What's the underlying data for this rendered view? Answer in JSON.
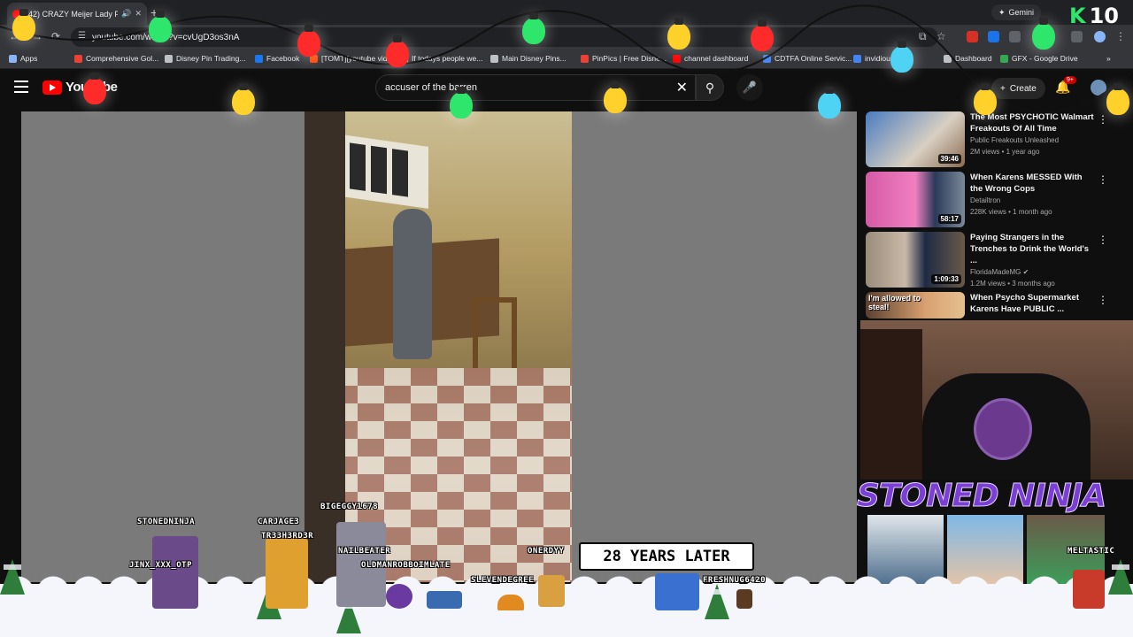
{
  "browser": {
    "tab_title": "(42) CRAZY Meijer Lady Fre",
    "new_tab": "+",
    "gemini_label": "Gemini",
    "url": "youtube.com/watch?v=cvUgD3os3nA"
  },
  "bookmarks": [
    {
      "label": "Apps",
      "color": "#8ab4f8"
    },
    {
      "label": "Comprehensive Gol...",
      "color": "#ea4335"
    },
    {
      "label": "Disney Pin Trading...",
      "color": "#bdc1c6"
    },
    {
      "label": "Facebook",
      "color": "#1877f2"
    },
    {
      "label": "[TOMT][youtube vid...",
      "color": "#ff4500"
    },
    {
      "label": "If todays people we...",
      "color": "#bdc1c6"
    },
    {
      "label": "Main Disney Pins...",
      "color": "#bdc1c6"
    },
    {
      "label": "PinPics | Free Disne...",
      "color": "#ea4335"
    },
    {
      "label": "channel dashboard",
      "color": "#ff0000"
    },
    {
      "label": "CDTFA Online Servic...",
      "color": "#4285f4"
    },
    {
      "label": "invidious",
      "color": "#4285f4"
    },
    {
      "label": "Dashboard",
      "color": "#bdc1c6"
    },
    {
      "label": "GFX - Google Drive",
      "color": "#34a853"
    }
  ],
  "youtube": {
    "logo_text": "YouTube",
    "search_query": "accuser of the barren",
    "create_label": "Create",
    "notification_count": "9+"
  },
  "recommendations": [
    {
      "title": "The Most PSYCHOTIC Walmart Freakouts Of All Time",
      "channel": "Public Freakouts Unleashed",
      "stats": "2M views • 1 year ago",
      "duration": "39:46",
      "thumb_color": "#a9a39a"
    },
    {
      "title": "When Karens MESSED With the Wrong Cops",
      "channel": "Detailtron",
      "stats": "228K views • 1 month ago",
      "duration": "58:17",
      "thumb_color": "#c65a9a"
    },
    {
      "title": "Paying Strangers in the Trenches to Drink the World's ...",
      "channel": "FloridaMadeMG",
      "stats": "1.2M views • 3 months ago",
      "duration": "1:09:33",
      "thumb_color": "#8d8272"
    },
    {
      "title": "When Psycho Supermarket Karens Have PUBLIC ...",
      "channel": "",
      "stats": "",
      "duration": "",
      "thumb_color": "#c8a060",
      "overlay_text": "I'm allowed to steal!"
    }
  ],
  "stream": {
    "title_overlay": "STONED NINJA",
    "caption": "28 YEARS LATER",
    "counter_value": "10",
    "viewers": [
      "STONEDNINJA",
      "JINX_XXX_OTP",
      "CARJAGE3",
      "TR33H3RD3R",
      "BIGEGGY1678",
      "NAILBEATER",
      "OLDMANROBBOIMLATE",
      "SLEVENDEGREE",
      "ONERDYY",
      "FRESHNUG6420",
      "MELTASTIC"
    ]
  }
}
